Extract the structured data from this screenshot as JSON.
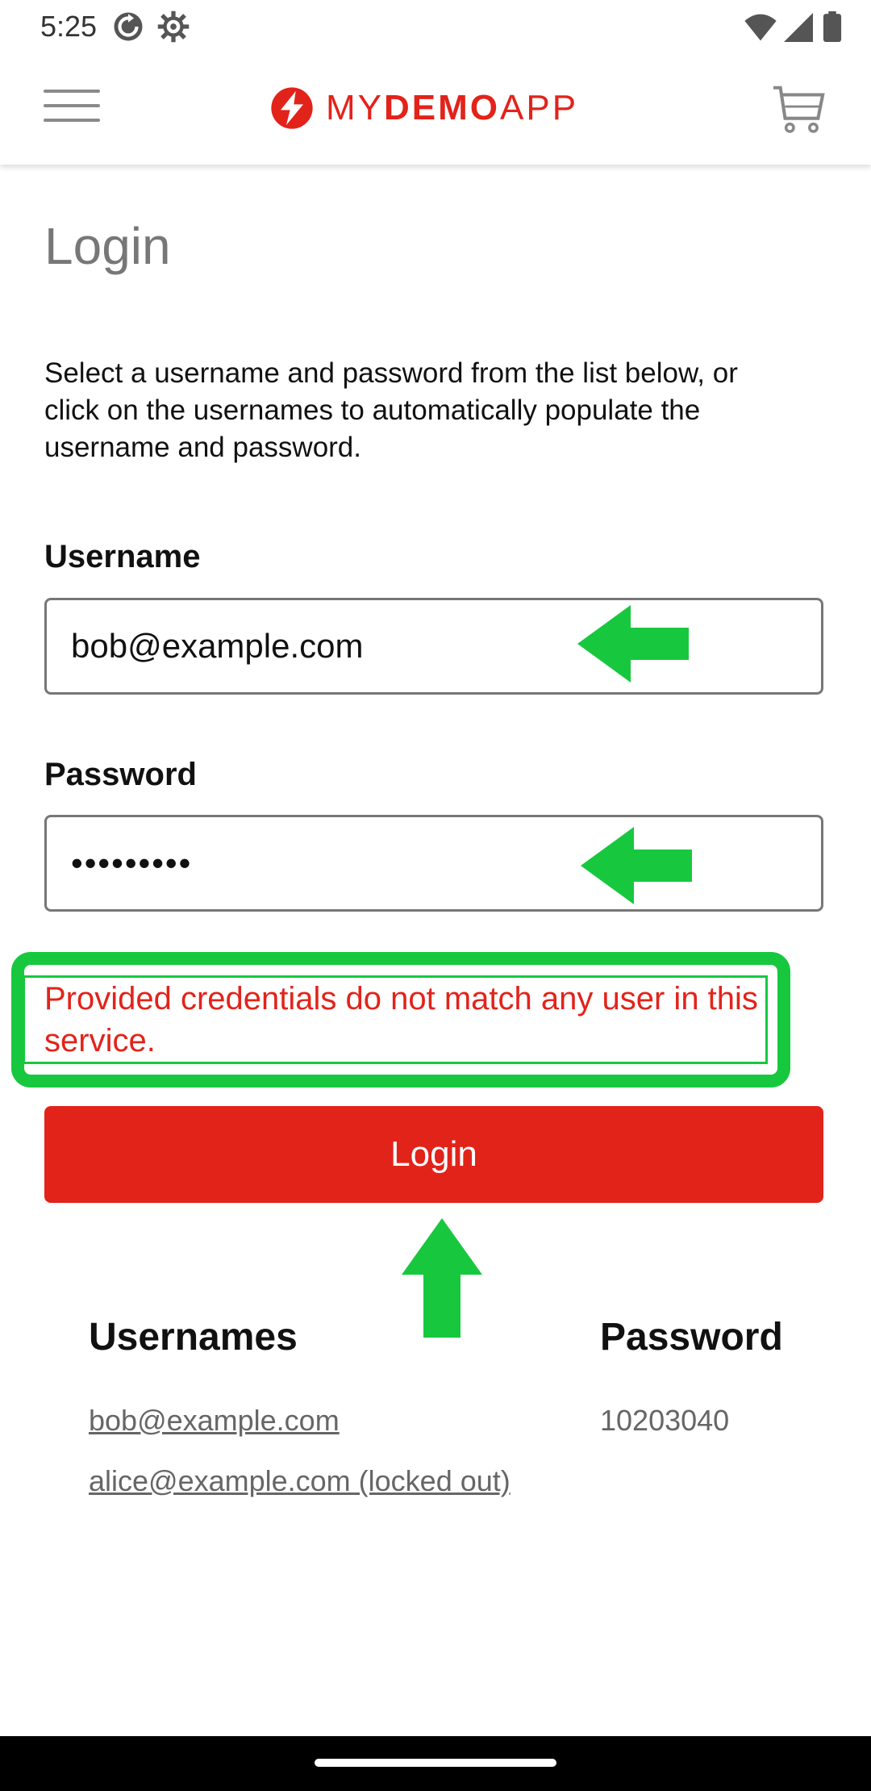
{
  "status_bar": {
    "time": "5:25"
  },
  "app_bar": {
    "brand_prefix": "MY",
    "brand_bold": "DEMO",
    "brand_suffix": "APP",
    "brand_color": "#e2231a"
  },
  "page": {
    "title": "Login",
    "intro": "Select a username and password from the list below, or click on the usernames to automatically populate the username and password."
  },
  "form": {
    "username_label": "Username",
    "username_value": "bob@example.com",
    "password_label": "Password",
    "password_value": "•••••••••",
    "error": "Provided credentials do not match any user in this service.",
    "login_label": "Login"
  },
  "credentials": {
    "usernames_header": "Usernames",
    "password_header": "Password",
    "users": [
      "bob@example.com",
      "alice@example.com (locked out)"
    ],
    "password": "10203040"
  },
  "annotations": {
    "highlight_color": "#17c83f"
  },
  "icons": [
    "sync-icon",
    "settings-icon",
    "wifi-icon",
    "signal-icon",
    "battery-icon",
    "menu-icon",
    "logo-icon",
    "cart-icon"
  ]
}
